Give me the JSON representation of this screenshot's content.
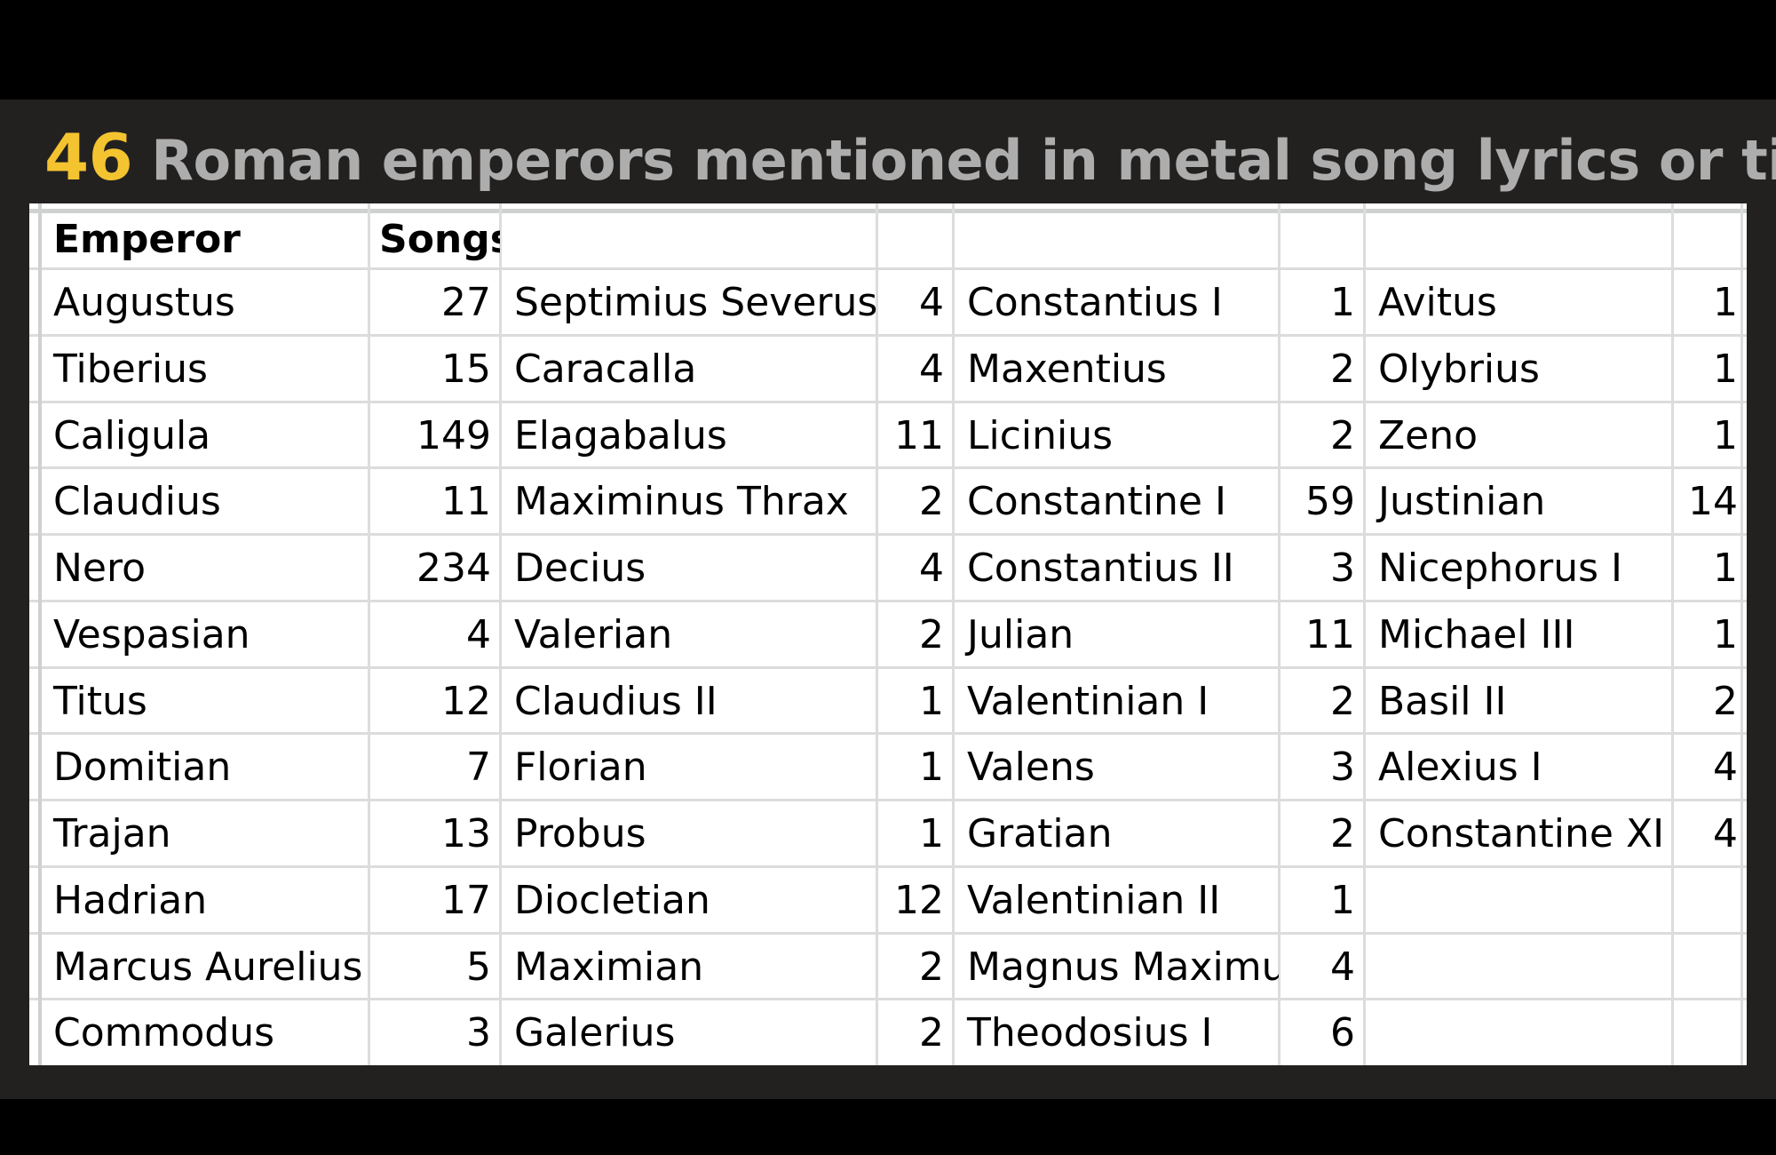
{
  "title": {
    "count": "46",
    "text": "Roman emperors mentioned in metal song lyrics or titles"
  },
  "colors": {
    "accent": "#F4C430",
    "title_text": "#ADADAD",
    "panel_bg": "#232120",
    "grid": "#DCDCDC"
  },
  "table": {
    "headers": [
      "Emperor",
      "Songs",
      "",
      "",
      "",
      "",
      "",
      ""
    ],
    "columns": [
      [
        {
          "emperor": "Augustus",
          "songs": "27"
        },
        {
          "emperor": "Tiberius",
          "songs": "15"
        },
        {
          "emperor": "Caligula",
          "songs": "149"
        },
        {
          "emperor": "Claudius",
          "songs": "11"
        },
        {
          "emperor": "Nero",
          "songs": "234"
        },
        {
          "emperor": "Vespasian",
          "songs": "4"
        },
        {
          "emperor": "Titus",
          "songs": "12"
        },
        {
          "emperor": "Domitian",
          "songs": "7"
        },
        {
          "emperor": "Trajan",
          "songs": "13"
        },
        {
          "emperor": "Hadrian",
          "songs": "17"
        },
        {
          "emperor": "Marcus Aurelius",
          "songs": "5"
        },
        {
          "emperor": "Commodus",
          "songs": "3"
        }
      ],
      [
        {
          "emperor": "Septimius Severus",
          "songs": "4"
        },
        {
          "emperor": "Caracalla",
          "songs": "4"
        },
        {
          "emperor": "Elagabalus",
          "songs": "11"
        },
        {
          "emperor": "Maximinus Thrax",
          "songs": "2"
        },
        {
          "emperor": "Decius",
          "songs": "4"
        },
        {
          "emperor": "Valerian",
          "songs": "2"
        },
        {
          "emperor": "Claudius II",
          "songs": "1"
        },
        {
          "emperor": "Florian",
          "songs": "1"
        },
        {
          "emperor": "Probus",
          "songs": "1"
        },
        {
          "emperor": "Diocletian",
          "songs": "12"
        },
        {
          "emperor": "Maximian",
          "songs": "2"
        },
        {
          "emperor": "Galerius",
          "songs": "2"
        }
      ],
      [
        {
          "emperor": "Constantius I",
          "songs": "1"
        },
        {
          "emperor": "Maxentius",
          "songs": "2"
        },
        {
          "emperor": "Licinius",
          "songs": "2"
        },
        {
          "emperor": "Constantine I",
          "songs": "59"
        },
        {
          "emperor": "Constantius II",
          "songs": "3"
        },
        {
          "emperor": "Julian",
          "songs": "11"
        },
        {
          "emperor": "Valentinian I",
          "songs": "2"
        },
        {
          "emperor": "Valens",
          "songs": "3"
        },
        {
          "emperor": "Gratian",
          "songs": "2"
        },
        {
          "emperor": "Valentinian II",
          "songs": "1"
        },
        {
          "emperor": "Magnus Maximus",
          "songs": "4"
        },
        {
          "emperor": "Theodosius I",
          "songs": "6"
        }
      ],
      [
        {
          "emperor": "Avitus",
          "songs": "1"
        },
        {
          "emperor": "Olybrius",
          "songs": "1"
        },
        {
          "emperor": "Zeno",
          "songs": "1"
        },
        {
          "emperor": "Justinian",
          "songs": "14"
        },
        {
          "emperor": "Nicephorus I",
          "songs": "1"
        },
        {
          "emperor": "Michael III",
          "songs": "1"
        },
        {
          "emperor": "Basil II",
          "songs": "2"
        },
        {
          "emperor": "Alexius I",
          "songs": "4"
        },
        {
          "emperor": "Constantine XI",
          "songs": "4"
        },
        {
          "emperor": "",
          "songs": ""
        },
        {
          "emperor": "",
          "songs": ""
        },
        {
          "emperor": "",
          "songs": ""
        }
      ]
    ]
  }
}
